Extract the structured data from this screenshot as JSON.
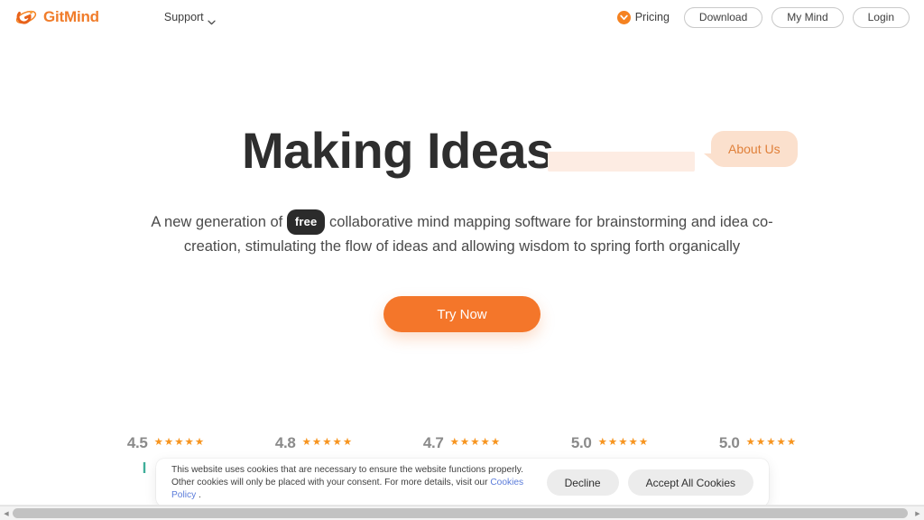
{
  "header": {
    "brand_name": "GitMind",
    "brand_mark_icon": "gitmind-swirl-logo-icon",
    "support_label": "Support",
    "support_chevron_icon": "chevron-down-icon",
    "pricing_label": "Pricing",
    "pricing_badge_icon": "orange-circle-chevron-icon",
    "download_label": "Download",
    "my_mind_label": "My Mind",
    "login_label": "Login"
  },
  "hero": {
    "headline": "Making Ideas",
    "typing_bar_color": "#fdece3",
    "bubble_label": "About Us",
    "bubble_bg": "#fbe0cd",
    "bubble_text_color": "#e0803a",
    "subhead_before": "A new generation of ",
    "subhead_pill": "free",
    "subhead_after": " collaborative mind mapping software for brainstorming and idea co-creation, stimulating the flow of ideas and allowing wisdom to spring forth organically",
    "cta_label": "Try Now",
    "cta_color": "#f4762a"
  },
  "ratings": [
    {
      "score": "4.5",
      "stars": "★★★★★",
      "logo_icon": "review-site-logo-1-icon",
      "logo_color": "#3fae9a"
    },
    {
      "score": "4.8",
      "stars": "★★★★★",
      "logo_icon": "review-site-logo-2-icon",
      "logo_color": "#e24a3a"
    },
    {
      "score": "4.7",
      "stars": "★★★★★",
      "logo_icon": "review-site-logo-3-icon",
      "logo_color": "#4fc3d6"
    },
    {
      "score": "5.0",
      "stars": "★★★★★",
      "logo_icon": "review-site-logo-4-icon",
      "logo_color": "#5b9fd6"
    },
    {
      "score": "5.0",
      "stars": "★★★★★",
      "logo_icon": "review-site-logo-5-icon",
      "logo_color": "#d94a2f"
    }
  ],
  "cookie": {
    "text_part1": "This website uses cookies that are necessary to ensure the website functions properly. Other cookies will only be placed with your consent. For more details, visit our ",
    "link_label": "Cookies Policy",
    "text_part2": " .",
    "decline_label": "Decline",
    "accept_label": "Accept All Cookies"
  },
  "scrollbar": {
    "left_arrow_icon": "scroll-left-arrow-icon",
    "right_arrow_icon": "scroll-right-arrow-icon",
    "left_glyph": "◀",
    "right_glyph": "▶"
  }
}
